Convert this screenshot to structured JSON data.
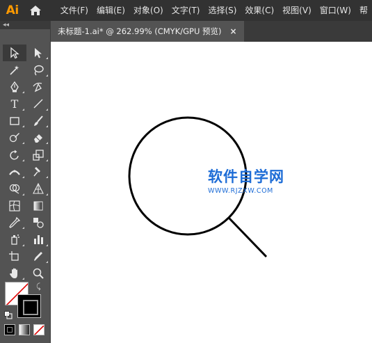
{
  "app": {
    "logo_text": "Ai",
    "brand_color": "#FF9A00"
  },
  "menubar": {
    "items": [
      {
        "label": "文件(F)"
      },
      {
        "label": "编辑(E)"
      },
      {
        "label": "对象(O)"
      },
      {
        "label": "文字(T)"
      },
      {
        "label": "选择(S)"
      },
      {
        "label": "效果(C)"
      },
      {
        "label": "视图(V)"
      },
      {
        "label": "窗口(W)"
      },
      {
        "label": "帮"
      }
    ]
  },
  "toolbar": {
    "collapse_glyph": "◂◂",
    "tools": [
      {
        "name": "selection-tool-icon",
        "selected": true
      },
      {
        "name": "direct-selection-tool-icon"
      },
      {
        "name": "magic-wand-tool-icon"
      },
      {
        "name": "lasso-tool-icon"
      },
      {
        "name": "pen-tool-icon"
      },
      {
        "name": "curvature-tool-icon"
      },
      {
        "name": "type-tool-icon"
      },
      {
        "name": "line-segment-tool-icon"
      },
      {
        "name": "rectangle-tool-icon"
      },
      {
        "name": "paintbrush-tool-icon"
      },
      {
        "name": "shaper-tool-icon"
      },
      {
        "name": "eraser-tool-icon"
      },
      {
        "name": "rotate-tool-icon"
      },
      {
        "name": "scale-tool-icon"
      },
      {
        "name": "width-tool-icon"
      },
      {
        "name": "puppet-warp-tool-icon"
      },
      {
        "name": "shape-builder-tool-icon"
      },
      {
        "name": "perspective-grid-tool-icon"
      },
      {
        "name": "mesh-tool-icon"
      },
      {
        "name": "gradient-tool-icon"
      },
      {
        "name": "eyedropper-tool-icon"
      },
      {
        "name": "blend-tool-icon"
      },
      {
        "name": "symbol-sprayer-tool-icon"
      },
      {
        "name": "column-graph-tool-icon"
      },
      {
        "name": "artboard-tool-icon"
      },
      {
        "name": "slice-tool-icon"
      },
      {
        "name": "hand-tool-icon"
      },
      {
        "name": "zoom-tool-icon"
      }
    ],
    "type_glyph": "T",
    "fill_color": "#FFFFFF",
    "stroke_color": "#000000"
  },
  "document": {
    "tab_title": "未标题-1.ai* @ 262.99% (CMYK/GPU 预览)",
    "close_glyph": "×"
  },
  "canvas": {
    "background": "#FFFFFF"
  },
  "watermark": {
    "title": "软件自学网",
    "url": "WWW.RJZXW.COM",
    "color": "#1D6CD6"
  }
}
